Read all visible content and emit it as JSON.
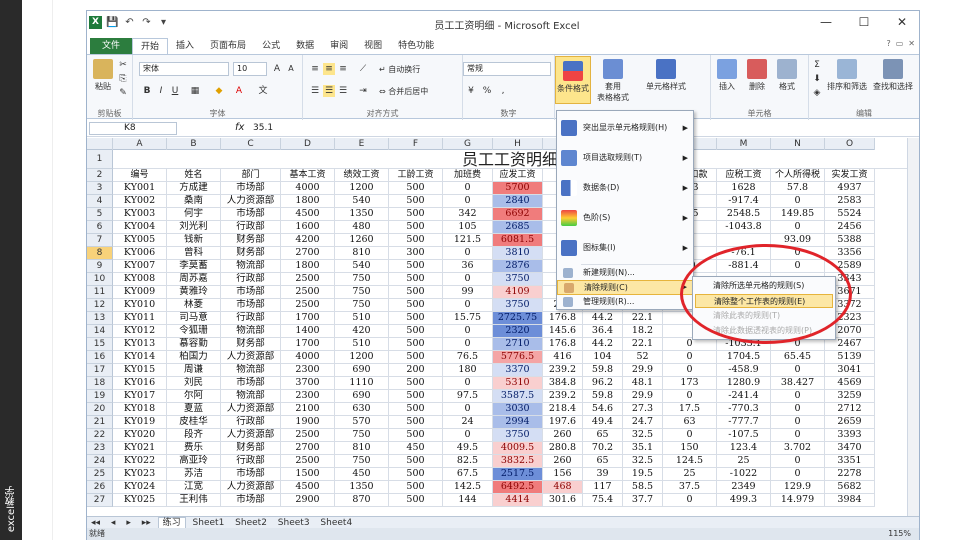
{
  "side_label": "excel教学",
  "window": {
    "title": "员工工资明细 - Microsoft Excel"
  },
  "qat": [
    "💾",
    "↶",
    "↷",
    "▾"
  ],
  "wbtns": [
    "—",
    "☐",
    "✕"
  ],
  "tabs": [
    "文件",
    "开始",
    "插入",
    "页面布局",
    "公式",
    "数据",
    "审阅",
    "视图",
    "特色功能"
  ],
  "ribbon": {
    "paste": "粘贴",
    "clipboard": "剪贴板",
    "font_name": "宋体",
    "font_size": "10",
    "font_group": "字体",
    "wrap": "自动换行",
    "merge": "合并后居中",
    "align_group": "对齐方式",
    "numfmt": "常规",
    "number_group": "数字",
    "cond": "条件格式",
    "table_fmt_a": "套用",
    "table_fmt_b": "表格格式",
    "cell_style": "单元格样式",
    "insert": "插入",
    "delete": "删除",
    "format": "格式",
    "cells_group": "单元格",
    "sortfilter": "排序和筛选",
    "findselect": "查找和选择",
    "edit_group": "编辑"
  },
  "formula_bar": {
    "name": "K8",
    "fx": "fx",
    "value": "35.1"
  },
  "columns": [
    "A",
    "B",
    "C",
    "D",
    "E",
    "F",
    "G",
    "H",
    "I",
    "J",
    "K",
    "L",
    "M",
    "N",
    "O"
  ],
  "sheet_title": "员工工资明细",
  "headers": [
    "编号",
    "姓名",
    "部门",
    "基本工资",
    "绩效工资",
    "工龄工资",
    "加班费",
    "应发工资",
    "养",
    "",
    "",
    "考勤扣款",
    "应税工资",
    "个人所得税",
    "实发工资"
  ],
  "rows": [
    [
      "KY001",
      "方成建",
      "市场部",
      "4000",
      "1200",
      "500",
      "0",
      "5700",
      "",
      "",
      "",
      "133",
      "1628",
      "57.8",
      "4937"
    ],
    [
      "KY002",
      "桑南",
      "人力资源部",
      "1800",
      "540",
      "500",
      "0",
      "2840",
      "",
      "",
      "",
      "0",
      "-917.4",
      "0",
      "2583"
    ],
    [
      "KY003",
      "何宇",
      "市场部",
      "4500",
      "1350",
      "500",
      "342",
      "6692",
      "",
      "",
      "",
      "375",
      "2548.5",
      "149.85",
      "5524"
    ],
    [
      "KY004",
      "刘光利",
      "行政部",
      "1600",
      "480",
      "500",
      "105",
      "2685",
      "",
      "",
      "",
      "0",
      "-1043.8",
      "0",
      "2456"
    ],
    [
      "KY005",
      "钱新",
      "财务部",
      "4200",
      "1260",
      "500",
      "121.5",
      "6081.5",
      "",
      "",
      "",
      "0",
      "",
      "93.09",
      "5388"
    ],
    [
      "KY006",
      "曾科",
      "财务部",
      "2700",
      "810",
      "300",
      "0",
      "3810",
      "",
      "",
      "",
      "",
      "-76.1",
      "0",
      "3356"
    ],
    [
      "KY007",
      "李莫蓄",
      "物流部",
      "1800",
      "540",
      "500",
      "36",
      "2876",
      "",
      "",
      "",
      "30",
      "-881.4",
      "0",
      "2589"
    ],
    [
      "KY008",
      "周苏嘉",
      "行政部",
      "2500",
      "750",
      "500",
      "0",
      "3750",
      "",
      "",
      "",
      "",
      "",
      "",
      "3343"
    ],
    [
      "KY009",
      "黄雅玲",
      "市场部",
      "2500",
      "750",
      "500",
      "99",
      "4109",
      "",
      "",
      "",
      "",
      "",
      "",
      "3671"
    ],
    [
      "KY010",
      "林菱",
      "市场部",
      "2500",
      "750",
      "500",
      "0",
      "3750",
      "260",
      "65",
      "32.5",
      "",
      "",
      "",
      "3372"
    ],
    [
      "KY011",
      "司马意",
      "行政部",
      "1700",
      "510",
      "500",
      "15.75",
      "2725.75",
      "176.8",
      "44.2",
      "22.1",
      "",
      "",
      "",
      "2323"
    ],
    [
      "KY012",
      "令狐珊",
      "物流部",
      "1400",
      "420",
      "500",
      "0",
      "2320",
      "145.6",
      "36.4",
      "18.2",
      "",
      "",
      "",
      "2070"
    ],
    [
      "KY013",
      "慕容勤",
      "财务部",
      "1700",
      "510",
      "500",
      "0",
      "2710",
      "176.8",
      "44.2",
      "22.1",
      "0",
      "-1033.1",
      "0",
      "2467"
    ],
    [
      "KY014",
      "柏国力",
      "人力资源部",
      "4000",
      "1200",
      "500",
      "76.5",
      "5776.5",
      "416",
      "104",
      "52",
      "0",
      "1704.5",
      "65.45",
      "5139"
    ],
    [
      "KY015",
      "周谦",
      "物流部",
      "2300",
      "690",
      "200",
      "180",
      "3370",
      "239.2",
      "59.8",
      "29.9",
      "0",
      "-458.9",
      "0",
      "3041"
    ],
    [
      "KY016",
      "刘民",
      "市场部",
      "3700",
      "1110",
      "500",
      "0",
      "5310",
      "384.8",
      "96.2",
      "48.1",
      "173",
      "1280.9",
      "38.427",
      "4569"
    ],
    [
      "KY017",
      "尔阿",
      "物流部",
      "2300",
      "690",
      "500",
      "97.5",
      "3587.5",
      "239.2",
      "59.8",
      "29.9",
      "0",
      "-241.4",
      "0",
      "3259"
    ],
    [
      "KY018",
      "夏蓝",
      "人力资源部",
      "2100",
      "630",
      "500",
      "0",
      "3030",
      "218.4",
      "54.6",
      "27.3",
      "17.5",
      "-770.3",
      "0",
      "2712"
    ],
    [
      "KY019",
      "皮桂华",
      "行政部",
      "1900",
      "570",
      "500",
      "24",
      "2994",
      "197.6",
      "49.4",
      "24.7",
      "63",
      "-777.7",
      "0",
      "2659"
    ],
    [
      "KY020",
      "段齐",
      "人力资源部",
      "2500",
      "750",
      "500",
      "0",
      "3750",
      "260",
      "65",
      "32.5",
      "0",
      "-107.5",
      "0",
      "3393"
    ],
    [
      "KY021",
      "费乐",
      "财务部",
      "2700",
      "810",
      "450",
      "49.5",
      "4009.5",
      "280.8",
      "70.2",
      "35.1",
      "150",
      "123.4",
      "3.702",
      "3470"
    ],
    [
      "KY022",
      "高亚玲",
      "行政部",
      "2500",
      "750",
      "500",
      "82.5",
      "3832.5",
      "260",
      "65",
      "32.5",
      "124.5",
      "25",
      "0",
      "3351"
    ],
    [
      "KY023",
      "苏洁",
      "市场部",
      "1500",
      "450",
      "500",
      "67.5",
      "2517.5",
      "156",
      "39",
      "19.5",
      "25",
      "-1022",
      "0",
      "2278"
    ],
    [
      "KY024",
      "江宽",
      "人力资源部",
      "4500",
      "1350",
      "500",
      "142.5",
      "6492.5",
      "468",
      "117",
      "58.5",
      "37.5",
      "2349",
      "129.9",
      "5682"
    ],
    [
      "KY025",
      "王利伟",
      "市场部",
      "2900",
      "870",
      "500",
      "144",
      "4414",
      "301.6",
      "75.4",
      "37.7",
      "0",
      "499.3",
      "14.979",
      "3984"
    ]
  ],
  "cf_colors": {
    "H": [
      "red1",
      "blu2",
      "red1",
      "blu2",
      "red1",
      "blu3",
      "blu2",
      "blu3",
      "red3",
      "blu3",
      "blu1",
      "blu1",
      "blu2",
      "red2",
      "blu3",
      "red3",
      "blu3",
      "blu2",
      "blu2",
      "blu3",
      "red3",
      "red3",
      "blu1",
      "red1",
      "red3"
    ],
    "I": [
      "",
      "",
      "",
      "",
      "",
      "",
      "",
      "",
      "",
      "",
      "",
      "",
      "",
      "",
      "",
      "",
      "",
      "",
      "",
      "",
      "",
      "",
      "",
      "red3",
      ""
    ]
  },
  "cf_menu": {
    "items": [
      "突出显示单元格规则(H)",
      "项目选取规则(T)",
      "数据条(D)",
      "色阶(S)",
      "图标集(I)"
    ],
    "small": [
      "新建规则(N)...",
      "清除规则(C)",
      "管理规则(R)..."
    ]
  },
  "clear_submenu": [
    "清除所选单元格的规则(S)",
    "清除整个工作表的规则(E)",
    "清除此表的规则(T)",
    "清除此数据透视表的规则(P)"
  ],
  "sheet_tabs": [
    "◂◂",
    "◂",
    "▸",
    "▸▸",
    "练习",
    "Sheet1",
    "Sheet2",
    "Sheet3",
    "Sheet4"
  ],
  "status": {
    "ready": "就绪",
    "zoom": "115%"
  }
}
